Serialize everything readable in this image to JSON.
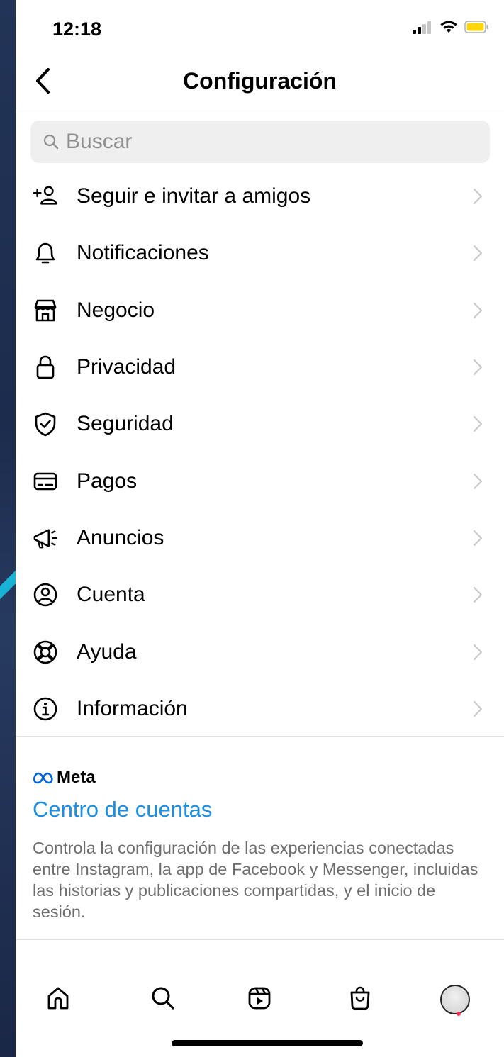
{
  "status_bar": {
    "time": "12:18"
  },
  "header": {
    "title": "Configuración",
    "back_icon": "chevron-left-icon"
  },
  "search": {
    "placeholder": "Buscar",
    "icon": "search-icon"
  },
  "menu": {
    "items": [
      {
        "label": "Seguir e invitar a amigos",
        "icon": "add-person-icon"
      },
      {
        "label": "Notificaciones",
        "icon": "bell-icon"
      },
      {
        "label": "Negocio",
        "icon": "storefront-icon"
      },
      {
        "label": "Privacidad",
        "icon": "lock-icon"
      },
      {
        "label": "Seguridad",
        "icon": "shield-check-icon"
      },
      {
        "label": "Pagos",
        "icon": "credit-card-icon"
      },
      {
        "label": "Anuncios",
        "icon": "megaphone-icon"
      },
      {
        "label": "Cuenta",
        "icon": "account-circle-icon"
      },
      {
        "label": "Ayuda",
        "icon": "lifebuoy-icon"
      },
      {
        "label": "Información",
        "icon": "info-icon"
      }
    ]
  },
  "meta": {
    "logo_text": "Meta",
    "accounts_center_label": "Centro de cuentas",
    "accounts_center_description": "Controla la configuración de las experiencias conectadas entre Instagram, la app de Facebook y Messenger, incluidas las historias y publicaciones compartidas, y el inicio de sesión."
  },
  "tabbar": {
    "items": [
      "home-icon",
      "search-icon",
      "reels-icon",
      "shop-bag-icon",
      "profile-avatar"
    ]
  },
  "colors": {
    "link": "#1a8fe3",
    "notification_dot": "#ff2d55",
    "battery": "#ffd60a"
  }
}
